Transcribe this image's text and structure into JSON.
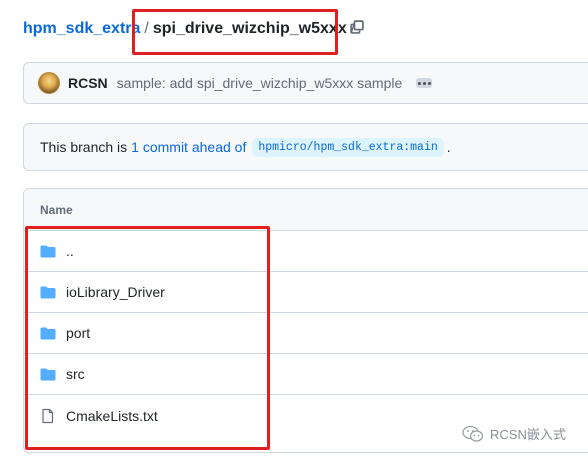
{
  "breadcrumb": {
    "root": "hpm_sdk_extra",
    "separator": "/",
    "current": "spi_drive_wizchip_w5xxx",
    "trailing": "/"
  },
  "icons": {
    "copy": "copy-icon",
    "folder": "folder-icon",
    "file": "file-icon",
    "more": "ellipsis-icon",
    "watermark": "wechat-icon"
  },
  "commit": {
    "author": "RCSN",
    "message": "sample: add spi_drive_wizchip_w5xxx sample"
  },
  "branch_status": {
    "prefix": "This branch is",
    "link": "1 commit ahead of",
    "ref": "hpmicro/hpm_sdk_extra:main",
    "suffix": "."
  },
  "file_table": {
    "header": "Name",
    "rows": [
      {
        "label": "..",
        "type": "folder"
      },
      {
        "label": "ioLibrary_Driver",
        "type": "folder"
      },
      {
        "label": "port",
        "type": "folder"
      },
      {
        "label": "src",
        "type": "folder"
      },
      {
        "label": "CmakeLists.txt",
        "type": "file"
      }
    ]
  },
  "watermark": {
    "text": "RCSN嵌入式"
  },
  "colors": {
    "link": "#0969da",
    "folder": "#54aeff",
    "highlight": "#e02020",
    "border": "#d0d7de"
  }
}
